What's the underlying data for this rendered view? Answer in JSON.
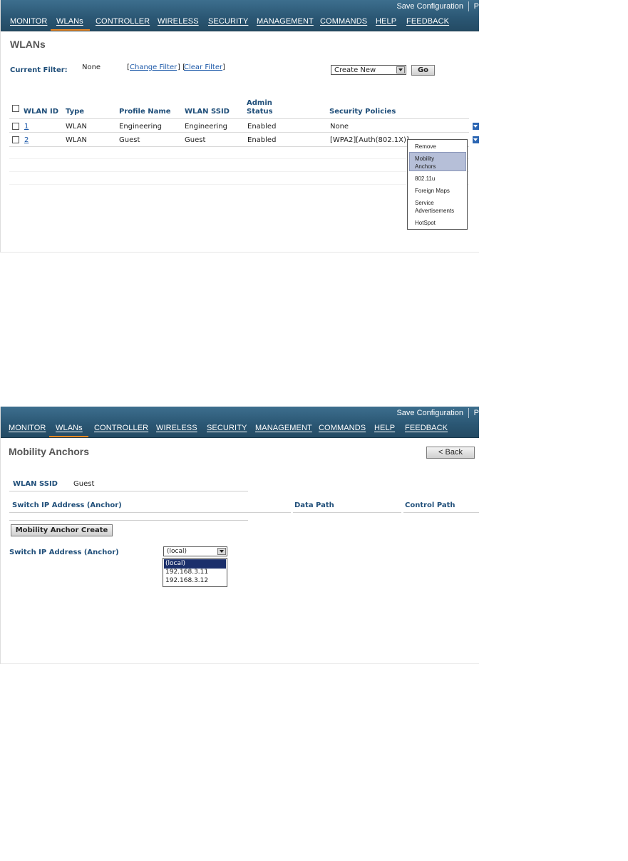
{
  "header": {
    "save_configuration": "Save Configuration",
    "cut_label": "P",
    "nav": [
      "MONITOR",
      "WLANs",
      "CONTROLLER",
      "WIRELESS",
      "SECURITY",
      "MANAGEMENT",
      "COMMANDS",
      "HELP",
      "FEEDBACK"
    ],
    "active_tab": "WLANs",
    "colors": {
      "bar": "#2b5774",
      "active": "#f08a24"
    }
  },
  "wlans_page": {
    "title": "WLANs",
    "current_filter_label": "Current Filter:",
    "current_filter_value": "None",
    "change_filter": "Change Filter",
    "clear_filter": "Clear Filter",
    "create_select_value": "Create New",
    "go_button": "Go",
    "columns": {
      "wlan_id": "WLAN ID",
      "type": "Type",
      "profile_name": "Profile Name",
      "wlan_ssid": "WLAN SSID",
      "admin_status_1": "Admin",
      "admin_status_2": "Status",
      "security_policies": "Security Policies"
    },
    "rows": [
      {
        "id": "1",
        "type": "WLAN",
        "profile": "Engineering",
        "ssid": "Engineering",
        "status": "Enabled",
        "security": "None"
      },
      {
        "id": "2",
        "type": "WLAN",
        "profile": "Guest",
        "ssid": "Guest",
        "status": "Enabled",
        "security": "[WPA2][Auth(802.1X)]"
      }
    ],
    "context_menu": [
      "Remove",
      "Mobility Anchors",
      "802.11u",
      "Foreign Maps",
      "Service Advertisements",
      "HotSpot"
    ],
    "context_menu_lines": [
      "Remove",
      "Mobility",
      "Anchors",
      "802.11u",
      "Foreign Maps",
      "Service",
      "Advertisements",
      "HotSpot"
    ],
    "context_menu_selected": "Mobility Anchors"
  },
  "anchors_page": {
    "title": "Mobility Anchors",
    "back_button": "< Back",
    "wlan_ssid_label": "WLAN SSID",
    "wlan_ssid_value": "Guest",
    "col_switch_ip": "Switch IP Address (Anchor)",
    "col_data_path": "Data Path",
    "col_control_path": "Control Path",
    "create_button": "Mobility Anchor Create",
    "switch_ip_label": "Switch IP Address (Anchor)",
    "select_value": "(local)",
    "options": [
      "(local)",
      "192.168.3.11",
      "192.168.3.12"
    ]
  }
}
